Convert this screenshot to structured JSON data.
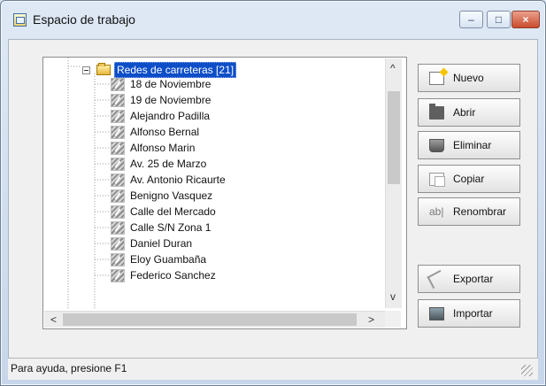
{
  "window": {
    "title": "Espacio de trabajo",
    "icons": [
      "workspace-icon",
      "minimize-icon",
      "maximize-icon",
      "close-icon"
    ]
  },
  "tree": {
    "root_label": "Redes de carreteras [21]",
    "items": [
      "18 de Noviembre",
      "19 de Noviembre",
      "Alejandro Padilla",
      "Alfonso Bernal",
      "Alfonso Marin",
      "Av. 25 de Marzo",
      "Av. Antonio Ricaurte",
      "Benigno Vasquez",
      "Calle del Mercado",
      "Calle S/N Zona 1",
      "Daniel Duran",
      "Eloy Guambaña",
      "Federico Sanchez"
    ]
  },
  "buttons": {
    "new": "Nuevo",
    "open": "Abrir",
    "delete": "Eliminar",
    "copy": "Copiar",
    "rename": "Renombrar",
    "rename_icon_text": "ab|",
    "export": "Exportar",
    "import": "Importar"
  },
  "status": {
    "text": "Para ayuda, presione F1"
  },
  "colors": {
    "selection": "#0d4ec8",
    "window_frame": "#c7d6ea",
    "client": "#f0f0f0",
    "close_button": "#c94c2b"
  }
}
